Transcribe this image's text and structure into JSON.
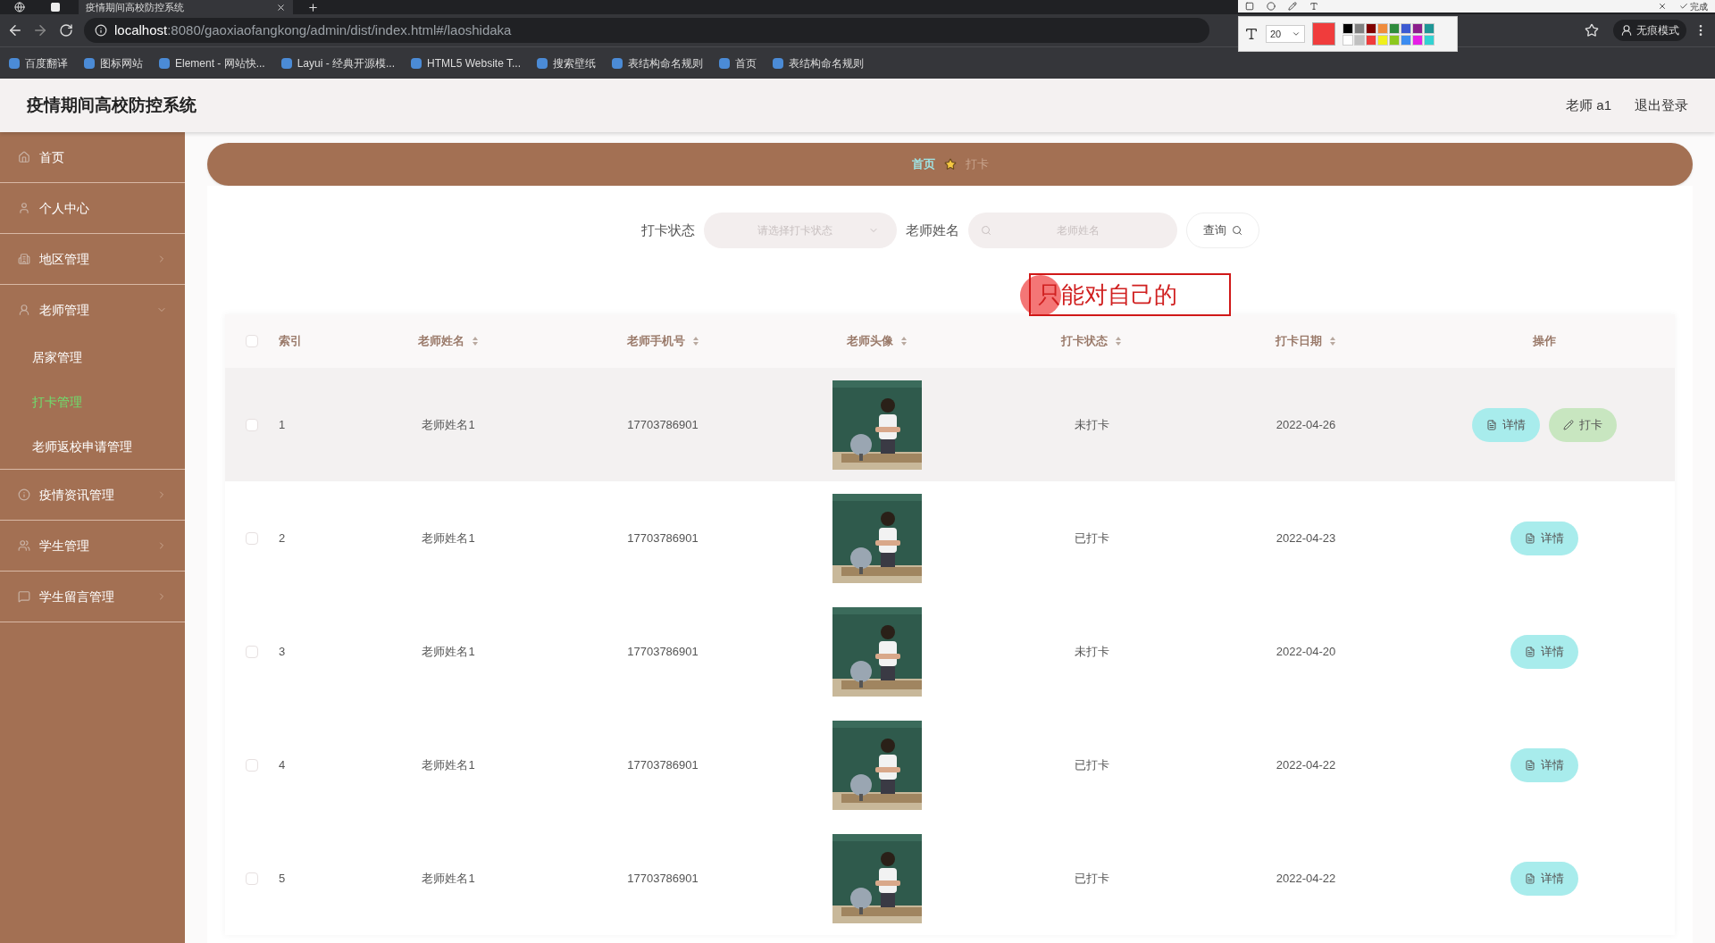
{
  "browser": {
    "tab_title": "疫情期间高校防控系统",
    "url_host": "localhost",
    "url_rest": ":8080/gaoxiaofangkong/admin/dist/index.html#/laoshidaka",
    "incognito": "无痕模式",
    "bookmarks": [
      "百度翻译",
      "图标网站",
      "Element - 网站快...",
      "Layui - 经典开源模...",
      "HTML5 Website T...",
      "搜索壁纸",
      "表结构命名规则",
      "首页",
      "表结构命名规则"
    ]
  },
  "annotation_toolbar": {
    "done": "完成",
    "font_size": "20",
    "swatches": [
      {
        "color": "#000000"
      },
      {
        "color": "#808080"
      },
      {
        "color": "#800000"
      },
      {
        "color": "#f08c3c"
      },
      {
        "color": "#2e8b3c"
      },
      {
        "color": "#3c5ad2"
      },
      {
        "color": "#8c1e8c"
      },
      {
        "color": "#1e9696"
      },
      {
        "color": "#ffffff"
      },
      {
        "color": "#c0c0c0"
      },
      {
        "color": "#f03c3c",
        "selected": true
      },
      {
        "color": "#f0f01e"
      },
      {
        "color": "#8cc81e"
      },
      {
        "color": "#3c8cf0"
      },
      {
        "color": "#e61ee6"
      },
      {
        "color": "#32d2d2"
      }
    ]
  },
  "annotation": {
    "text": "只能对自己的"
  },
  "header": {
    "title": "疫情期间高校防控系统",
    "user": "老师 a1",
    "logout": "退出登录"
  },
  "sidebar": {
    "items": [
      {
        "label": "首页"
      },
      {
        "label": "个人中心"
      },
      {
        "label": "地区管理",
        "expanded": false
      },
      {
        "label": "老师管理",
        "expanded": true,
        "children": [
          {
            "label": "居家管理",
            "selected": false
          },
          {
            "label": "打卡管理",
            "selected": true
          },
          {
            "label": "老师返校申请管理",
            "selected": false
          }
        ]
      },
      {
        "label": "疫情资讯管理",
        "expanded": false
      },
      {
        "label": "学生管理",
        "expanded": false
      },
      {
        "label": "学生留言管理",
        "expanded": false
      }
    ]
  },
  "breadcrumb": {
    "home": "首页",
    "current": "打卡"
  },
  "filters": {
    "status_label": "打卡状态",
    "status_placeholder": "请选择打卡状态",
    "name_label": "老师姓名",
    "name_placeholder": "老师姓名",
    "search_button": "查询"
  },
  "table": {
    "select_all_checked": false,
    "columns": [
      {
        "label": "索引",
        "sortable": false
      },
      {
        "label": "老师姓名",
        "sortable": true
      },
      {
        "label": "老师手机号",
        "sortable": true
      },
      {
        "label": "老师头像",
        "sortable": true
      },
      {
        "label": "打卡状态",
        "sortable": true
      },
      {
        "label": "打卡日期",
        "sortable": true
      },
      {
        "label": "操作",
        "sortable": false
      }
    ],
    "rows": [
      {
        "index": "1",
        "name": "老师姓名1",
        "phone": "17703786901",
        "status": "未打卡",
        "date": "2022-04-26",
        "hovered": true,
        "checked": false,
        "actions": [
          {
            "kind": "detail",
            "label": "详情"
          },
          {
            "kind": "checkin",
            "label": "打卡"
          }
        ]
      },
      {
        "index": "2",
        "name": "老师姓名1",
        "phone": "17703786901",
        "status": "已打卡",
        "date": "2022-04-23",
        "hovered": false,
        "checked": false,
        "actions": [
          {
            "kind": "detail",
            "label": "详情"
          }
        ]
      },
      {
        "index": "3",
        "name": "老师姓名1",
        "phone": "17703786901",
        "status": "未打卡",
        "date": "2022-04-20",
        "hovered": false,
        "checked": false,
        "actions": [
          {
            "kind": "detail",
            "label": "详情"
          }
        ]
      },
      {
        "index": "4",
        "name": "老师姓名1",
        "phone": "17703786901",
        "status": "已打卡",
        "date": "2022-04-22",
        "hovered": false,
        "checked": false,
        "actions": [
          {
            "kind": "detail",
            "label": "详情"
          }
        ]
      },
      {
        "index": "5",
        "name": "老师姓名1",
        "phone": "17703786901",
        "status": "已打卡",
        "date": "2022-04-22",
        "hovered": false,
        "checked": false,
        "actions": [
          {
            "kind": "detail",
            "label": "详情"
          }
        ]
      }
    ]
  }
}
